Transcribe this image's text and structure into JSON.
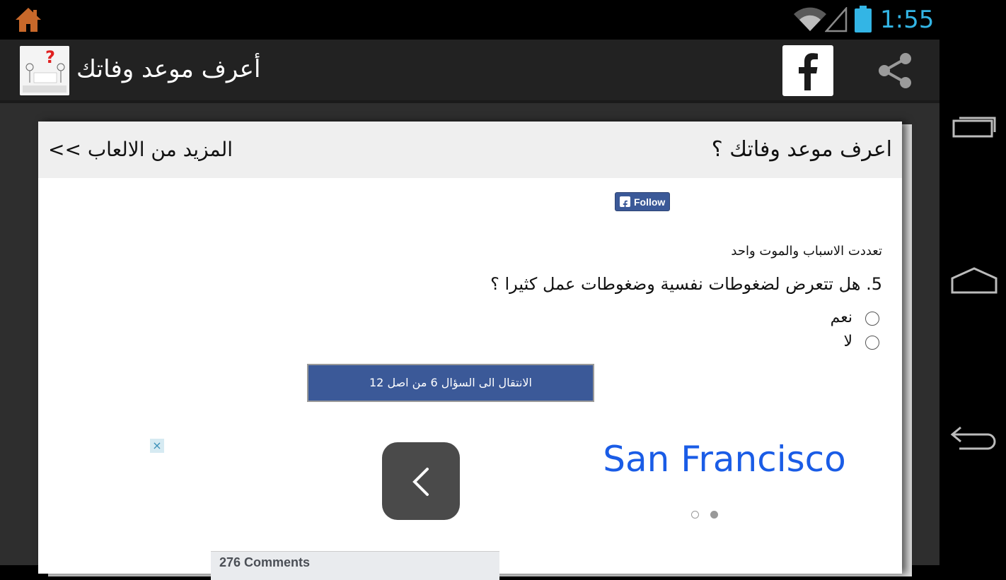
{
  "status_bar": {
    "time": "1:55",
    "icons": [
      "home-icon",
      "wifi-icon",
      "signal-icon",
      "battery-icon"
    ]
  },
  "action_bar": {
    "title": "أعرف موعد وفاتك",
    "app_icon_text": "أعرف موعد وفاتك",
    "facebook_label": "f",
    "icons": [
      "app-icon",
      "facebook-icon",
      "share-icon"
    ]
  },
  "nav_bar": {
    "icons": [
      "recents-icon",
      "home-icon",
      "back-icon"
    ]
  },
  "page": {
    "heading": "اعرف موعد وفاتك ؟",
    "more_games": "المزيد من الالعاب >>",
    "follow_label": "Follow",
    "proverb": "تعددت الاسباب والموت واحد",
    "question": "5. هل تتعرض لضغوطات نفسية وضغوطات عمل كثيرا ؟",
    "options": [
      {
        "label": "نعم",
        "selected": false
      },
      {
        "label": "لا",
        "selected": false
      }
    ],
    "next_button": "الانتقال الى السؤال 6 من اصل 12"
  },
  "ad": {
    "close_label": "×",
    "text": "San Francisco",
    "pages": 2,
    "current_page": 2
  },
  "comments": {
    "count_label": "276 Comments"
  },
  "colors": {
    "accent_blue": "#33b5e5",
    "facebook_blue": "#3b5998",
    "ad_text_blue": "#1a5ce6",
    "action_bar": "#222222"
  }
}
